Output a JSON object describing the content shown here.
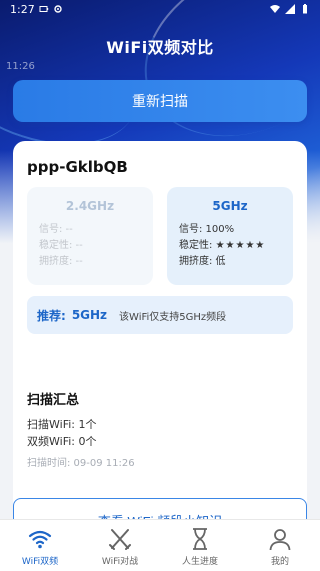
{
  "status_bar": {
    "time": "1:27",
    "icons": [
      "battery-outline-icon",
      "settings-icon",
      "wifi-icon",
      "signal-icon",
      "battery-icon"
    ]
  },
  "header": {
    "title": "WiFi双频对比",
    "overlay_time": "11:26"
  },
  "rescan_button": "重新扫描",
  "card": {
    "ssid": "ppp-GklbQB",
    "bands": [
      {
        "name": "2.4GHz",
        "signal": "信号: --",
        "stability": "稳定性: --",
        "congestion": "拥挤度: --"
      },
      {
        "name": "5GHz",
        "signal": "信号: 100%",
        "stability_label": "稳定性: ",
        "stars": "★★★★★",
        "congestion": "拥挤度: 低"
      }
    ],
    "recommend": {
      "label": "推荐:",
      "band": "5GHz",
      "description": "该WiFi仅支持5GHz频段"
    }
  },
  "summary": {
    "title": "扫描汇总",
    "scanned": "扫描WiFi: 1个",
    "dual": "双频WiFi: 0个",
    "time": "扫描时间: 09-09 11:26"
  },
  "knowledge_button": "查看 WiFi 频段小知识",
  "tabs": [
    {
      "label": "WiFi双频",
      "icon": "wifi-icon",
      "active": true
    },
    {
      "label": "WiFi对战",
      "icon": "crossed-swords-icon",
      "active": false
    },
    {
      "label": "人生进度",
      "icon": "hourglass-icon",
      "active": false
    },
    {
      "label": "我的",
      "icon": "user-icon",
      "active": false
    }
  ],
  "colors": {
    "accent": "#1d66c8",
    "header_dark": "#0a1b6e",
    "button": "#2a7be6"
  }
}
